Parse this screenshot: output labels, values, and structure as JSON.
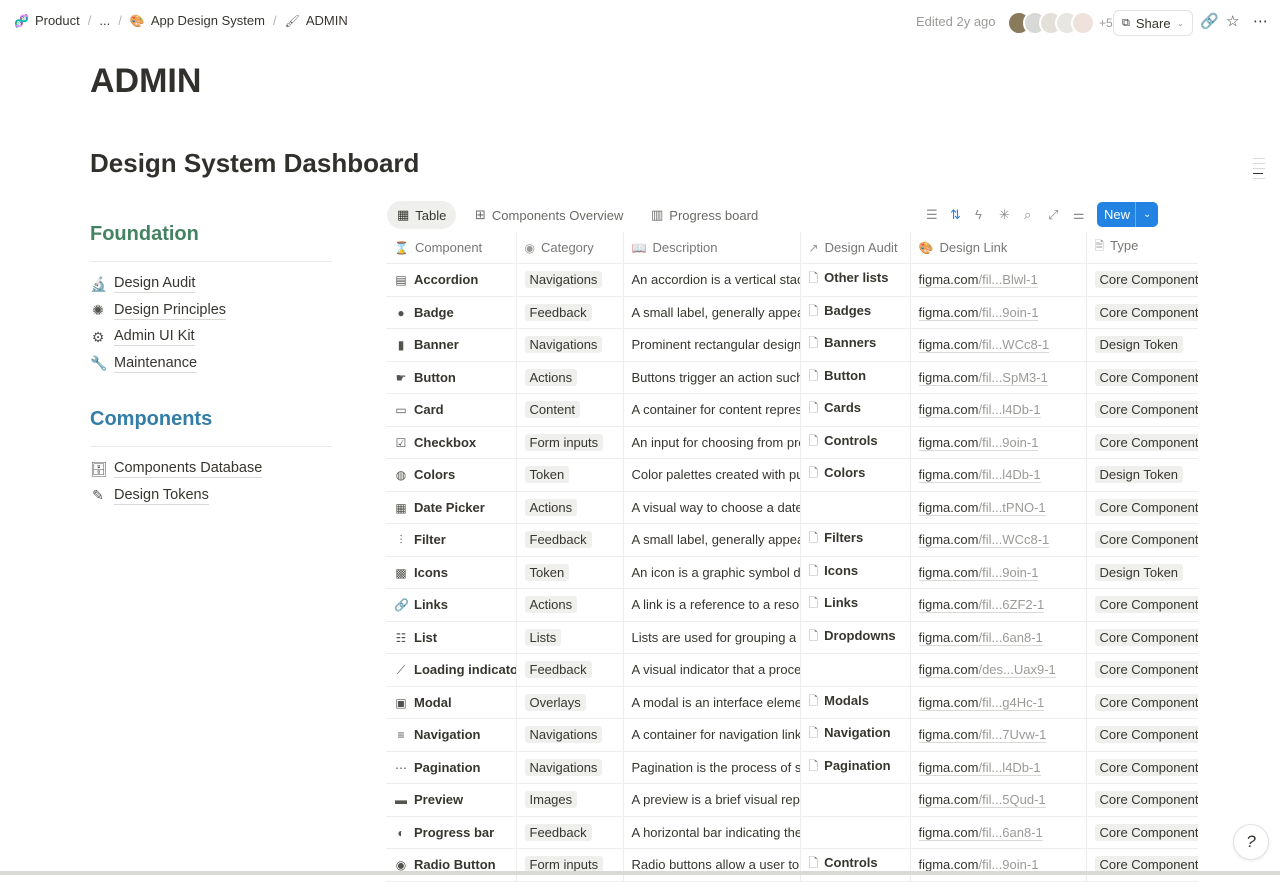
{
  "breadcrumb": {
    "items": [
      {
        "label": "Product",
        "icon": "dna-icon"
      },
      {
        "label": "..."
      },
      {
        "label": "App Design System",
        "icon": "palette-icon"
      },
      {
        "label": "ADMIN",
        "icon": "brush-icon"
      }
    ]
  },
  "header": {
    "edited": "Edited 2y ago",
    "avatar_extra": "+5",
    "share_label": "Share"
  },
  "page": {
    "title": "ADMIN",
    "subtitle": "Design System Dashboard"
  },
  "sidebar": {
    "foundation_heading": "Foundation",
    "foundation_color": "#448361",
    "foundation_items": [
      {
        "label": "Design Audit",
        "icon": "microscope-icon"
      },
      {
        "label": "Design Principles",
        "icon": "sparkle-icon"
      },
      {
        "label": "Admin UI Kit",
        "icon": "gears-icon"
      },
      {
        "label": "Maintenance",
        "icon": "wrench-icon"
      }
    ],
    "components_heading": "Components",
    "components_color": "#337ea9",
    "components_items": [
      {
        "label": "Components Database",
        "icon": "database-icon"
      },
      {
        "label": "Design Tokens",
        "icon": "token-edit-icon"
      }
    ]
  },
  "views": {
    "tabs": [
      "Table",
      "Components Overview",
      "Progress board"
    ],
    "active": "Table",
    "new_label": "New"
  },
  "table": {
    "columns": [
      "Component",
      "Category",
      "Description",
      "Design Audit",
      "Design Link",
      "Type"
    ],
    "rows": [
      {
        "component": "Accordion",
        "category": "Navigations",
        "description": "An accordion is a vertical stac",
        "audit": "Other lists",
        "link_a": "figma.com",
        "link_b": "/fil...Blwl-1",
        "type": "Core Component"
      },
      {
        "component": "Badge",
        "category": "Feedback",
        "description": "A small label, generally appea",
        "audit": "Badges",
        "link_a": "figma.com",
        "link_b": "/fil...9oin-1",
        "type": "Core Component"
      },
      {
        "component": "Banner",
        "category": "Navigations",
        "description": "Prominent rectangular design",
        "audit": "Banners",
        "link_a": "figma.com",
        "link_b": "/fil...WCc8-1",
        "type": "Design Token"
      },
      {
        "component": "Button",
        "category": "Actions",
        "description": "Buttons trigger an action such",
        "audit": "Button",
        "link_a": "figma.com",
        "link_b": "/fil...SpM3-1",
        "type": "Core Component"
      },
      {
        "component": "Card",
        "category": "Content",
        "description": "A container for content repres",
        "audit": "Cards",
        "link_a": "figma.com",
        "link_b": "/fil...l4Db-1",
        "type": "Core Component"
      },
      {
        "component": "Checkbox",
        "category": "Form inputs",
        "description": "An input for choosing from pre",
        "audit": "Controls",
        "link_a": "figma.com",
        "link_b": "/fil...9oin-1",
        "type": "Core Component"
      },
      {
        "component": "Colors",
        "category": "Token",
        "description": "Color palettes created with pu",
        "audit": "Colors",
        "link_a": "figma.com",
        "link_b": "/fil...l4Db-1",
        "type": "Design Token"
      },
      {
        "component": "Date Picker",
        "category": "Actions",
        "description": "A visual way to choose a date",
        "audit": "",
        "link_a": "figma.com",
        "link_b": "/fil...tPNO-1",
        "type": "Core Component"
      },
      {
        "component": "Filter",
        "category": "Feedback",
        "description": "A small label, generally appea",
        "audit": "Filters",
        "link_a": "figma.com",
        "link_b": "/fil...WCc8-1",
        "type": "Core Component"
      },
      {
        "component": "Icons",
        "category": "Token",
        "description": "An icon is a graphic symbol de",
        "audit": "Icons",
        "link_a": "figma.com",
        "link_b": "/fil...9oin-1",
        "type": "Design Token"
      },
      {
        "component": "Links",
        "category": "Actions",
        "description": "A link is a reference to a resou",
        "audit": "Links",
        "link_a": "figma.com",
        "link_b": "/fil...6ZF2-1",
        "type": "Core Component"
      },
      {
        "component": "List",
        "category": "Lists",
        "description": "Lists are used for grouping a c",
        "audit": "Dropdowns",
        "link_a": "figma.com",
        "link_b": "/fil...6an8-1",
        "type": "Core Component"
      },
      {
        "component": "Loading indicator",
        "category": "Feedback",
        "description": "A visual indicator that a proce",
        "audit": "",
        "link_a": "figma.com",
        "link_b": "/des...Uax9-1",
        "type": "Core Component"
      },
      {
        "component": "Modal",
        "category": "Overlays",
        "description": "A modal is an interface eleme",
        "audit": "Modals",
        "link_a": "figma.com",
        "link_b": "/fil...g4Hc-1",
        "type": "Core Component"
      },
      {
        "component": "Navigation",
        "category": "Navigations",
        "description": "A container for navigation link",
        "audit": "Navigation",
        "link_a": "figma.com",
        "link_b": "/fil...7Uvw-1",
        "type": "Core Component"
      },
      {
        "component": "Pagination",
        "category": "Navigations",
        "description": "Pagination is the process of sp",
        "audit": "Pagination",
        "link_a": "figma.com",
        "link_b": "/fil...l4Db-1",
        "type": "Core Component"
      },
      {
        "component": "Preview",
        "category": "Images",
        "description": "A preview is a brief visual repr",
        "audit": "",
        "link_a": "figma.com",
        "link_b": "/fil...5Qud-1",
        "type": "Core Component"
      },
      {
        "component": "Progress bar",
        "category": "Feedback",
        "description": "A horizontal bar indicating the",
        "audit": "",
        "link_a": "figma.com",
        "link_b": "/fil...6an8-1",
        "type": "Core Component"
      },
      {
        "component": "Radio Button",
        "category": "Form inputs",
        "description": "Radio buttons allow a user to",
        "audit": "Controls",
        "link_a": "figma.com",
        "link_b": "/fil...9oin-1",
        "type": "Core Component"
      }
    ]
  }
}
